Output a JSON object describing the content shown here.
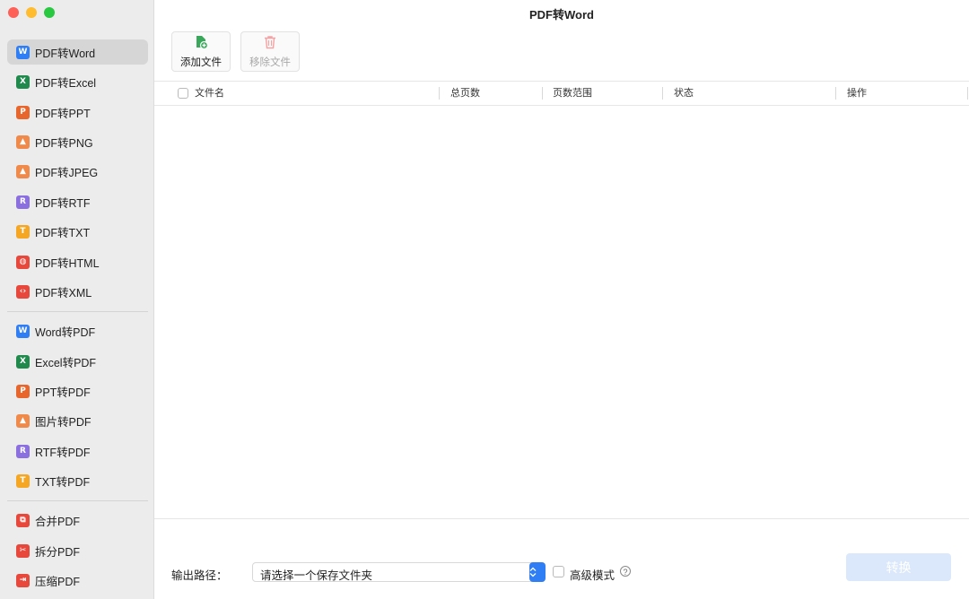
{
  "window": {
    "title": "PDF转Word"
  },
  "sidebar": {
    "groups": [
      [
        {
          "label": "PDF转Word",
          "icon": "W",
          "color": "#2f7ef6",
          "active": true
        },
        {
          "label": "PDF转Excel",
          "icon": "X",
          "color": "#1f8a4c"
        },
        {
          "label": "PDF转PPT",
          "icon": "P",
          "color": "#e8662b"
        },
        {
          "label": "PDF转PNG",
          "icon": "▲",
          "color": "#f08a4b"
        },
        {
          "label": "PDF转JPEG",
          "icon": "▲",
          "color": "#f08a4b"
        },
        {
          "label": "PDF转RTF",
          "icon": "R",
          "color": "#8b6fe0"
        },
        {
          "label": "PDF转TXT",
          "icon": "T",
          "color": "#f5a623"
        },
        {
          "label": "PDF转HTML",
          "icon": "◍",
          "color": "#e8473c"
        },
        {
          "label": "PDF转XML",
          "icon": "‹›",
          "color": "#e8473c"
        }
      ],
      [
        {
          "label": "Word转PDF",
          "icon": "W",
          "color": "#2f7ef6"
        },
        {
          "label": "Excel转PDF",
          "icon": "X",
          "color": "#1f8a4c"
        },
        {
          "label": "PPT转PDF",
          "icon": "P",
          "color": "#e8662b"
        },
        {
          "label": "图片转PDF",
          "icon": "▲",
          "color": "#f08a4b"
        },
        {
          "label": "RTF转PDF",
          "icon": "R",
          "color": "#8b6fe0"
        },
        {
          "label": "TXT转PDF",
          "icon": "T",
          "color": "#f5a623"
        }
      ],
      [
        {
          "label": "合并PDF",
          "icon": "⧉",
          "color": "#e8473c"
        },
        {
          "label": "拆分PDF",
          "icon": "✂",
          "color": "#e8473c"
        },
        {
          "label": "压缩PDF",
          "icon": "⇥",
          "color": "#e8473c"
        }
      ]
    ]
  },
  "toolbar": {
    "add_label": "添加文件",
    "remove_label": "移除文件"
  },
  "table": {
    "columns": [
      "文件名",
      "总页数",
      "页数范围",
      "状态",
      "操作"
    ]
  },
  "footer": {
    "output_label": "输出路径：",
    "output_placeholder": "请选择一个保存文件夹",
    "advanced_label": "高级模式",
    "convert_label": "转换"
  },
  "colors": {
    "accent": "#2f7ef6",
    "convert_disabled": "#dbe8fb"
  }
}
